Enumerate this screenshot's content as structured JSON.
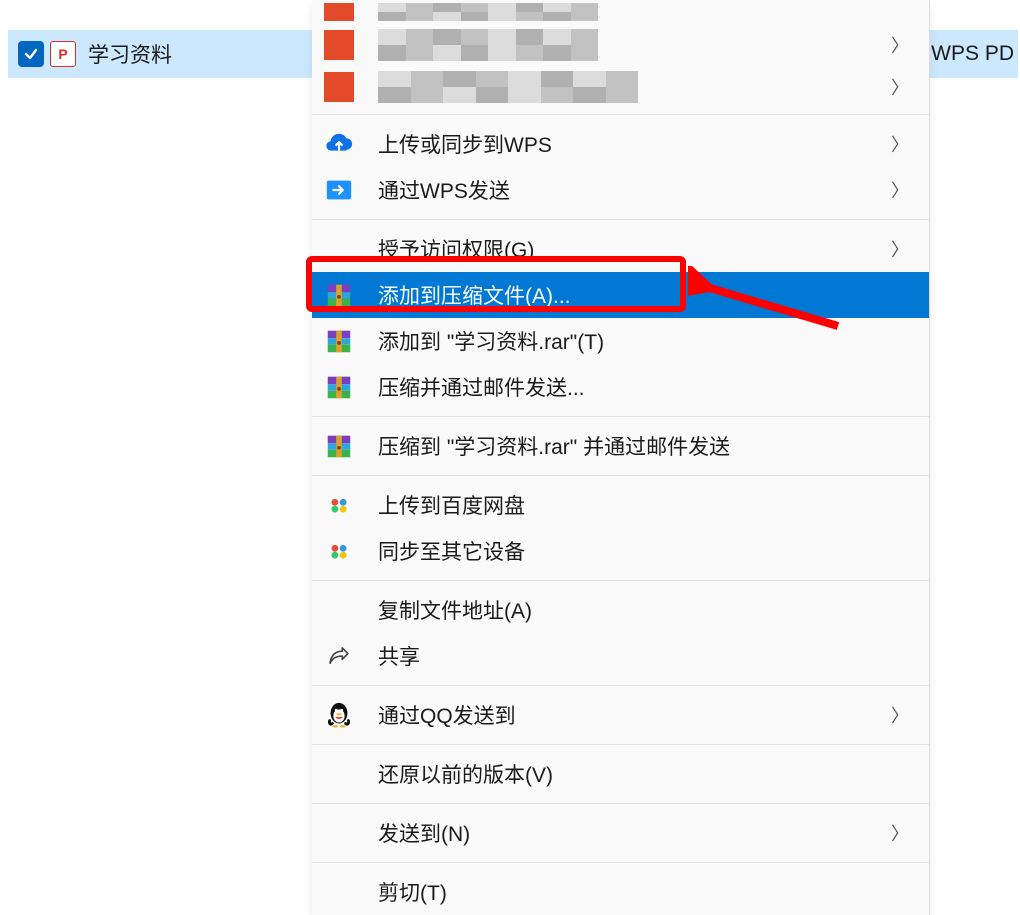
{
  "file": {
    "name": "学习资料",
    "type_label": "WPS PD"
  },
  "blurred": [
    {
      "color": "#e24a2a"
    },
    {
      "color": "#e24a2a"
    }
  ],
  "menu": [
    {
      "id": "wps-upload",
      "label": "上传或同步到WPS",
      "icon": "cloud-upload-icon",
      "submenu": true
    },
    {
      "id": "wps-send",
      "label": "通过WPS发送",
      "icon": "arrow-folder-icon",
      "submenu": true
    },
    {
      "sep": true
    },
    {
      "id": "grant-access",
      "label": "授予访问权限(G)",
      "icon": "",
      "submenu": true
    },
    {
      "id": "add-archive",
      "label": "添加到压缩文件(A)...",
      "icon": "winrar-icon",
      "highlight": true
    },
    {
      "id": "add-rar",
      "label": "添加到 \"学习资料.rar\"(T)",
      "icon": "winrar-icon"
    },
    {
      "id": "compress-mail",
      "label": "压缩并通过邮件发送...",
      "icon": "winrar-icon"
    },
    {
      "sep": true
    },
    {
      "id": "compress-to-rar-mail",
      "label": "压缩到 \"学习资料.rar\" 并通过邮件发送",
      "icon": "winrar-icon"
    },
    {
      "sep": true
    },
    {
      "id": "baidu-upload",
      "label": "上传到百度网盘",
      "icon": "baidu-icon"
    },
    {
      "id": "baidu-sync",
      "label": "同步至其它设备",
      "icon": "baidu-icon"
    },
    {
      "sep": true
    },
    {
      "id": "copy-path",
      "label": "复制文件地址(A)",
      "icon": ""
    },
    {
      "id": "share",
      "label": "共享",
      "icon": "share-icon"
    },
    {
      "sep": true
    },
    {
      "id": "qq-send",
      "label": "通过QQ发送到",
      "icon": "qq-icon",
      "submenu": true
    },
    {
      "sep": true
    },
    {
      "id": "restore-ver",
      "label": "还原以前的版本(V)",
      "icon": ""
    },
    {
      "sep": true
    },
    {
      "id": "send-to",
      "label": "发送到(N)",
      "icon": "",
      "submenu": true
    },
    {
      "sep": true
    },
    {
      "id": "cut",
      "label": "剪切(T)",
      "icon": ""
    }
  ]
}
